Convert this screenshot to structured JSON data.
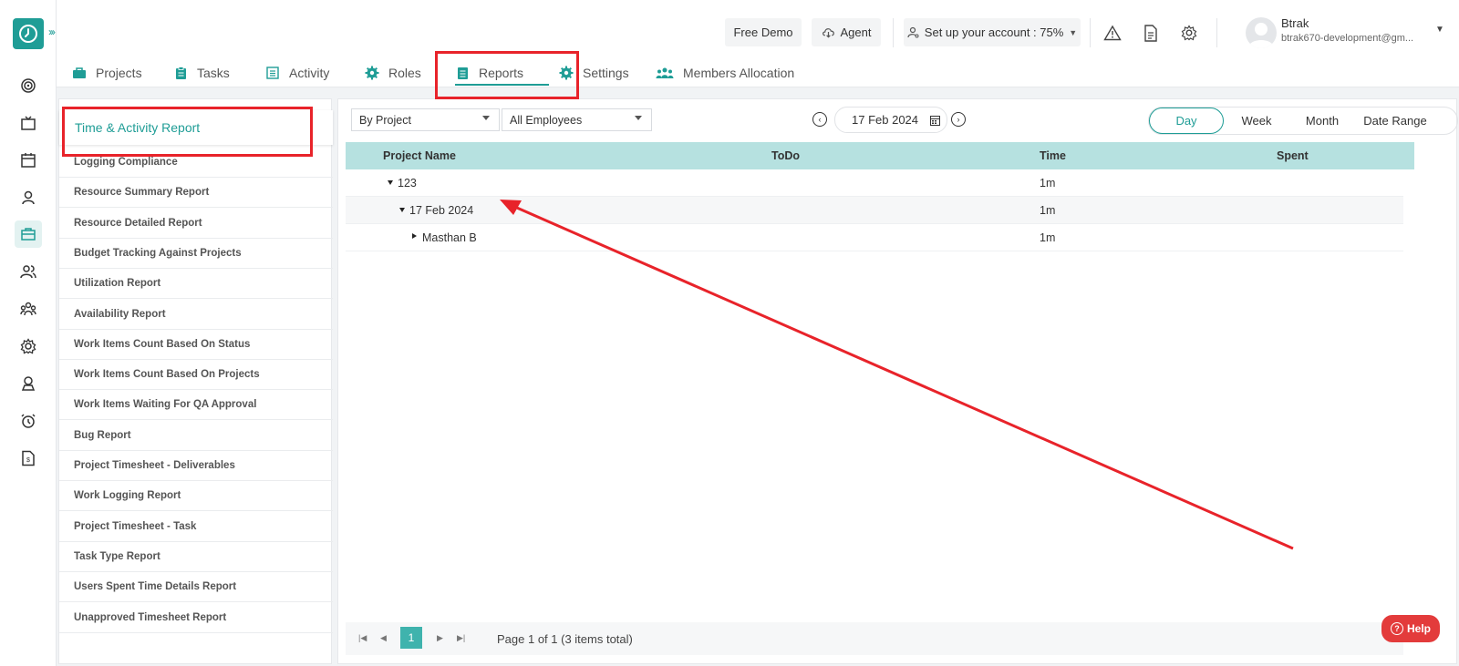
{
  "topbar": {
    "free_demo": "Free Demo",
    "agent": "Agent",
    "setup": "Set up your account : 75%",
    "user_name": "Btrak",
    "user_email": "btrak670-development@gm..."
  },
  "nav": {
    "tabs": [
      {
        "label": "Projects",
        "icon": "briefcase-icon"
      },
      {
        "label": "Tasks",
        "icon": "clipboard-icon"
      },
      {
        "label": "Activity",
        "icon": "list-icon"
      },
      {
        "label": "Roles",
        "icon": "gear-icon"
      },
      {
        "label": "Reports",
        "icon": "document-icon"
      },
      {
        "label": "Settings",
        "icon": "gear-icon"
      },
      {
        "label": "Members Allocation",
        "icon": "users-icon"
      }
    ],
    "active": "Reports"
  },
  "reports": {
    "selected": "Time & Activity Report",
    "items": [
      "Logging Compliance",
      "Resource Summary Report",
      "Resource Detailed Report",
      "Budget Tracking Against Projects",
      "Utilization Report",
      "Availability Report",
      "Work Items Count Based On Status",
      "Work Items Count Based On Projects",
      "Work Items Waiting For QA Approval",
      "Bug Report",
      "Project Timesheet - Deliverables",
      "Work Logging Report",
      "Project Timesheet - Task",
      "Task Type Report",
      "Users Spent Time Details Report",
      "Unapproved Timesheet Report"
    ]
  },
  "filters": {
    "group_by": "By Project",
    "employees": "All Employees",
    "date": "17 Feb 2024",
    "periods": [
      "Day",
      "Week",
      "Month",
      "Date Range"
    ],
    "active_period": "Day"
  },
  "table": {
    "headers": {
      "project": "Project Name",
      "todo": "ToDo",
      "time": "Time",
      "spent": "Spent"
    },
    "rows": [
      {
        "label": "123",
        "time": "1m",
        "expanded": true,
        "level": 0
      },
      {
        "label": "17 Feb 2024",
        "time": "1m",
        "expanded": true,
        "level": 1
      },
      {
        "label": "Masthan B",
        "time": "1m",
        "expanded": false,
        "level": 2
      }
    ]
  },
  "pager": {
    "page": "1",
    "info": "Page 1 of 1 (3 items total)"
  },
  "help": {
    "label": "Help"
  },
  "colors": {
    "accent": "#1f9d96",
    "highlight": "#e8232a",
    "table_header": "#b6e1e0"
  }
}
